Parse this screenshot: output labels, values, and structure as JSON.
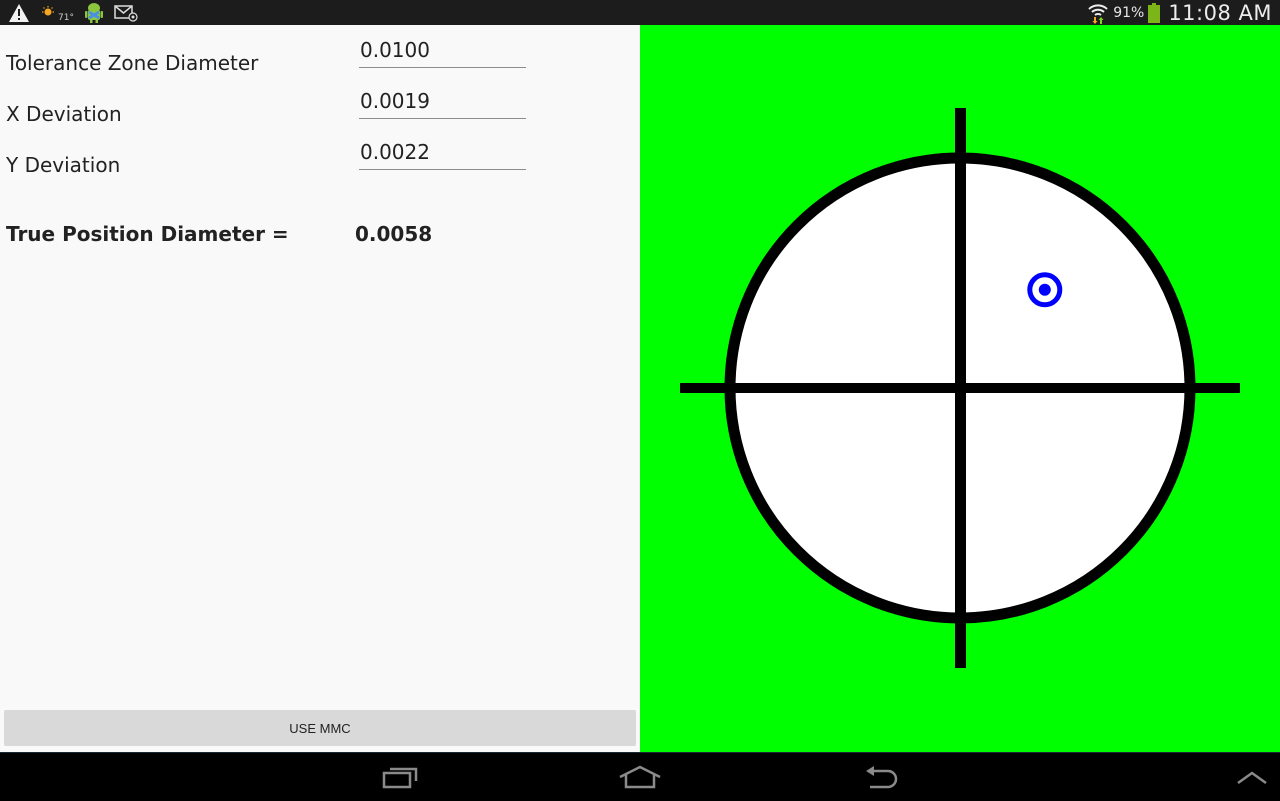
{
  "status_bar": {
    "left_icons": [
      "warning-icon",
      "weather-sun-icon",
      "android-debug-icon",
      "email-sync-icon"
    ],
    "temperature": "71°",
    "right_icons": [
      "wifi-icon",
      "battery-icon"
    ],
    "battery_percent": "91%",
    "time": "11:08 AM"
  },
  "form": {
    "fields": [
      {
        "label": "Tolerance Zone Diameter",
        "value": "0.0100"
      },
      {
        "label": "X Deviation",
        "value": "0.0019"
      },
      {
        "label": "Y Deviation",
        "value": "0.0022"
      }
    ],
    "result_label": "True Position Diameter =",
    "result_value": "0.0058",
    "mmc_button_label": "USE MMC"
  },
  "canvas": {
    "background_color": "#00ff00",
    "zone_fill_color": "#ffffff",
    "line_color": "#000000",
    "marker_color": "#0000ff",
    "tolerance_zone_diameter": 0.01,
    "x_deviation": 0.0019,
    "y_deviation": 0.0022,
    "status": "within-tolerance"
  },
  "nav_bar": {
    "buttons": [
      "recent-apps",
      "home",
      "back",
      "menu-up"
    ]
  }
}
